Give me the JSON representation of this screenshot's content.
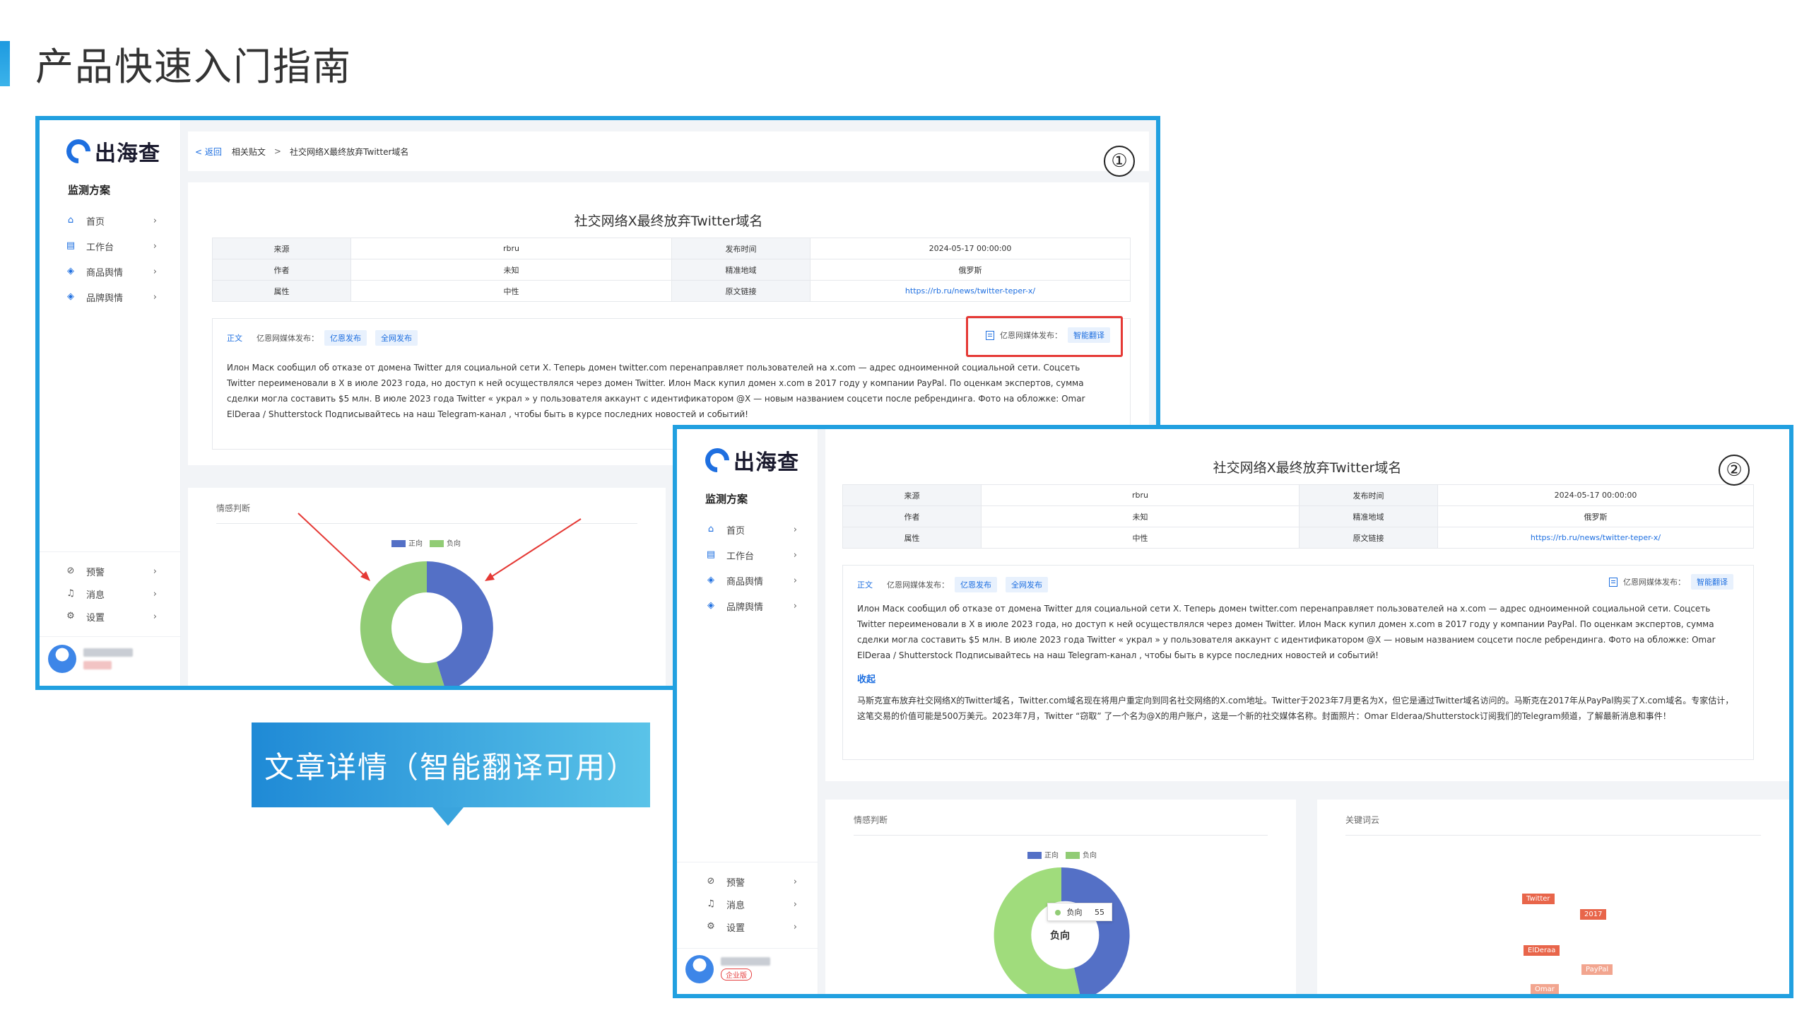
{
  "page": {
    "title": "产品快速入门指南",
    "banner": "文章详情（智能翻译可用）"
  },
  "markers": {
    "one": "①",
    "two": "②"
  },
  "app": {
    "logo_text": "出海查",
    "menu_head": "监测方案",
    "menu": [
      {
        "label": "首页",
        "icon": "home-icon"
      },
      {
        "label": "工作台",
        "icon": "workbench-icon"
      },
      {
        "label": "商品舆情",
        "icon": "layers-icon"
      },
      {
        "label": "品牌舆情",
        "icon": "layers-icon"
      }
    ],
    "bottom_menu": [
      {
        "label": "预警",
        "icon": "alert-off-icon"
      },
      {
        "label": "消息",
        "icon": "bell-icon"
      },
      {
        "label": "设置",
        "icon": "gear-icon"
      }
    ],
    "enterprise_badge": "企业版",
    "arrow": "›"
  },
  "breadcrumb": {
    "back": "< 返回",
    "section": "相关贴文",
    "sep": ">",
    "current": "社交网络X最终放弃Twitter域名"
  },
  "article": {
    "title": "社交网络X最终放弃Twitter域名",
    "meta": {
      "source_label": "来源",
      "source": "rbru",
      "time_label": "发布时间",
      "time": "2024-05-17 00:00:00",
      "author_label": "作者",
      "author": "未知",
      "region_label": "精准地域",
      "region": "俄罗斯",
      "attr_label": "属性",
      "attr": "中性",
      "link_label": "原文链接",
      "link": "https://rb.ru/news/twitter-teper-x/"
    },
    "tab_main": "正文",
    "publish_label": "亿恩网媒体发布：",
    "chip1": "亿恩发布",
    "chip2": "全网发布",
    "right_label": "亿恩网媒体发布：",
    "smart_translate": "智能翻译",
    "body": "Илон Маск сообщил об отказе от домена Twitter для социальной сети X. Теперь домен twitter.com перенаправляет пользователей на x.com — адрес одноименной социальной сети. Соцсеть Twitter переименовали в X в июле 2023 года, но доступ к ней осуществлялся через домен Twitter. Илон Маск купил домен x.com в 2017 году у компании PayPal. По оценкам экспертов, сумма сделки могла составить $5 млн. В июле 2023 года Twitter « украл » у пользователя аккаунт с идентификатором @X — новым названием соцсети после ребрендинга. Фото на обложке: Omar ElDeraa / Shutterstock Подписывайтесь на наш Telegram-канал , чтобы быть в курсе последних новостей и событий!",
    "collapse": "收起",
    "translation": "马斯克宣布放弃社交网络X的Twitter域名，Twitter.com域名现在将用户重定向到同名社交网络的X.com地址。Twitter于2023年7月更名为X，但它是通过Twitter域名访问的。马斯克在2017年从PayPal购买了X.com域名。专家估计，这笔交易的价值可能是500万美元。2023年7月，Twitter “窃取” 了一个名为@X的用户账户，这是一个新的社交媒体名称。封面照片：Omar Elderaa/Shutterstock订阅我们的Telegram频道，了解最新消息和事件！"
  },
  "sentiment": {
    "title": "情感判断",
    "legend": [
      "正向",
      "负向"
    ],
    "colors": {
      "positive": "#5470c6",
      "negative": "#91cc75"
    },
    "tooltip_label": "负向",
    "tooltip_value": "55",
    "center_label": "负向"
  },
  "keywords": {
    "title": "关键词云",
    "tags": [
      {
        "text": "Twitter",
        "color": "#e8654a"
      },
      {
        "text": "2017",
        "color": "#e8654a"
      },
      {
        "text": "ElDeraa",
        "color": "#e8654a"
      },
      {
        "text": "PayPal",
        "color": "#f2a58f"
      },
      {
        "text": "Omar",
        "color": "#f2a58f"
      }
    ]
  }
}
